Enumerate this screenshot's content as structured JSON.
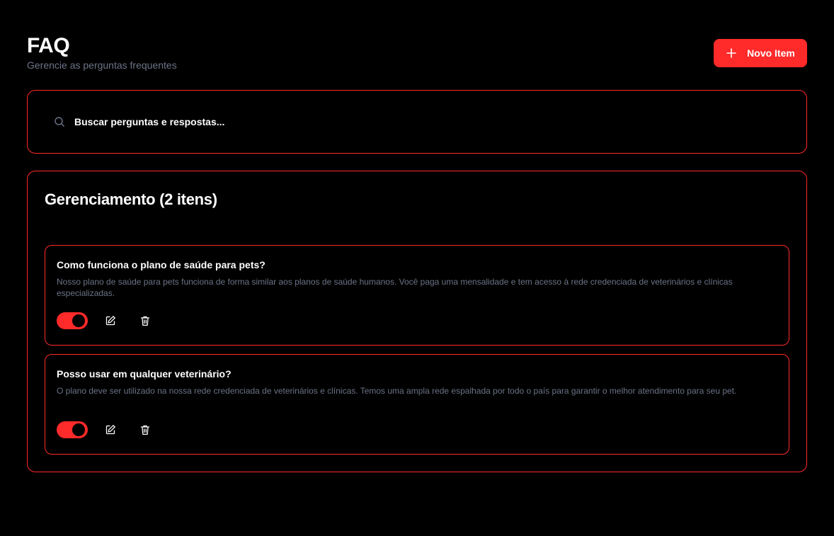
{
  "header": {
    "title": "FAQ",
    "subtitle": "Gerencie as perguntas frequentes",
    "new_button_label": "Novo Item",
    "new_button_icon": "plus-icon"
  },
  "search": {
    "placeholder": "Buscar perguntas e respostas...",
    "value": "",
    "icon": "search-icon"
  },
  "section": {
    "title": "Gerenciamento (2 itens)"
  },
  "items": [
    {
      "question": "Como funciona o plano de saúde para pets?",
      "answer": "Nosso plano de saúde para pets funciona de forma similar aos planos de saúde humanos. Você paga uma mensalidade e tem acesso à rede credenciada de veterinários e clínicas especializadas.",
      "active": true
    },
    {
      "question": "Posso usar em qualquer veterinário?",
      "answer": "O plano deve ser utilizado na nossa rede credenciada de veterinários e clínicas. Temos uma ampla rede espalhada por todo o país para garantir o melhor atendimento para seu pet.",
      "active": true
    }
  ],
  "colors": {
    "background": "#000000",
    "accent": "#ff2a2a",
    "muted_text": "#6b7386",
    "text": "#ffffff"
  }
}
